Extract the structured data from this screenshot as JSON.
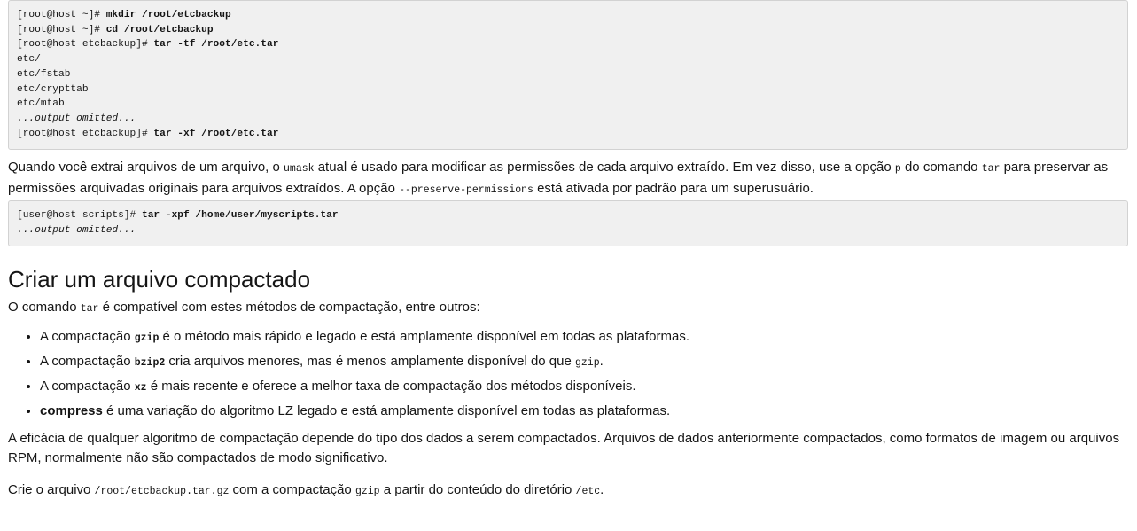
{
  "block1": {
    "lines": [
      {
        "prompt": "[root@host ~]# ",
        "cmd": "mkdir /root/etcbackup"
      },
      {
        "prompt": "[root@host ~]# ",
        "cmd": "cd /root/etcbackup"
      },
      {
        "prompt": "[root@host etcbackup]# ",
        "cmd": "tar -tf /root/etc.tar"
      },
      {
        "text": "etc/"
      },
      {
        "text": "etc/fstab"
      },
      {
        "text": "etc/crypttab"
      },
      {
        "text": "etc/mtab"
      },
      {
        "italic": "...output omitted..."
      },
      {
        "prompt": "[root@host etcbackup]# ",
        "cmd": "tar -xf /root/etc.tar"
      }
    ]
  },
  "para1": {
    "t1": "Quando você extrai arquivos de um arquivo, o ",
    "c1": "umask",
    "t2": " atual é usado para modificar as permissões de cada arquivo extraído. Em vez disso, use a opção ",
    "c2": "p",
    "t3": " do comando ",
    "c3": "tar",
    "t4": " para preservar as permissões arquivadas originais para arquivos extraídos. A opção ",
    "c4": "--preserve-permissions",
    "t5": " está ativada por padrão para um superusuário."
  },
  "block2": {
    "prompt": "[user@host scripts]# ",
    "cmd": "tar -xpf /home/user/myscripts.tar",
    "output": "...output omitted..."
  },
  "section": {
    "heading": "Criar um arquivo compactado",
    "intro_t1": "O comando ",
    "intro_c1": "tar",
    "intro_t2": " é compatível com estes métodos de compactação, entre outros:",
    "items": [
      {
        "t1": "A compactação ",
        "c1": "gzip",
        "t2": " é o método mais rápido e legado e está amplamente disponível em todas as plataformas."
      },
      {
        "t1": "A compactação ",
        "c1": "bzip2",
        "t2": " cria arquivos menores, mas é menos amplamente disponível do que ",
        "c2": "gzip",
        "t3": "."
      },
      {
        "t1": "A compactação ",
        "c1": "xz",
        "t2": " é mais recente e oferece a melhor taxa de compactação dos métodos disponíveis."
      },
      {
        "b1": "compress",
        "t1": " é uma variação do algoritmo LZ legado e está amplamente disponível em todas as plataformas."
      }
    ],
    "efficacy": "A eficácia de qualquer algoritmo de compactação depende do tipo dos dados a serem compactados. Arquivos de dados anteriormente compactados, como formatos de imagem ou arquivos RPM, normalmente não são compactados de modo significativo.",
    "create_t1": "Crie o arquivo ",
    "create_c1": "/root/etcbackup.tar.gz",
    "create_t2": " com a compactação ",
    "create_c2": "gzip",
    "create_t3": " a partir do conteúdo do diretório ",
    "create_c3": "/etc",
    "create_t4": "."
  }
}
